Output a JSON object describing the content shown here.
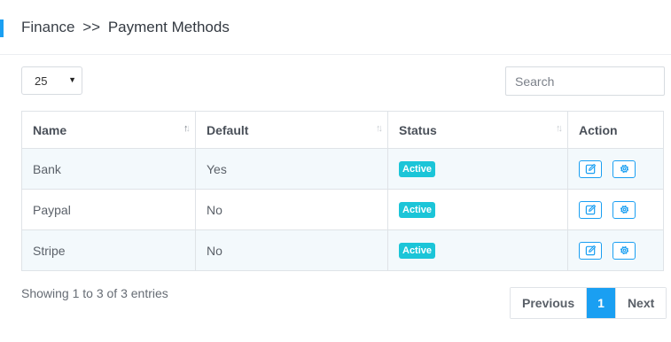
{
  "header": {
    "breadcrumb_root": "Finance",
    "breadcrumb_sep": ">>",
    "breadcrumb_current": "Payment Methods"
  },
  "controls": {
    "page_size": "25",
    "search_placeholder": "Search"
  },
  "table": {
    "columns": [
      "Name",
      "Default",
      "Status",
      "Action"
    ],
    "rows": [
      {
        "name": "Bank",
        "default": "Yes",
        "status": "Active"
      },
      {
        "name": "Paypal",
        "default": "No",
        "status": "Active"
      },
      {
        "name": "Stripe",
        "default": "No",
        "status": "Active"
      }
    ]
  },
  "footer": {
    "info": "Showing 1 to 3 of 3 entries",
    "prev_label": "Previous",
    "current_page": "1",
    "next_label": "Next"
  },
  "colors": {
    "accent": "#1a9ff2",
    "badge": "#1bc5d8",
    "row_stripe": "#f3f9fc"
  },
  "icons": {
    "edit": "edit-icon",
    "settings": "gear-icon"
  }
}
